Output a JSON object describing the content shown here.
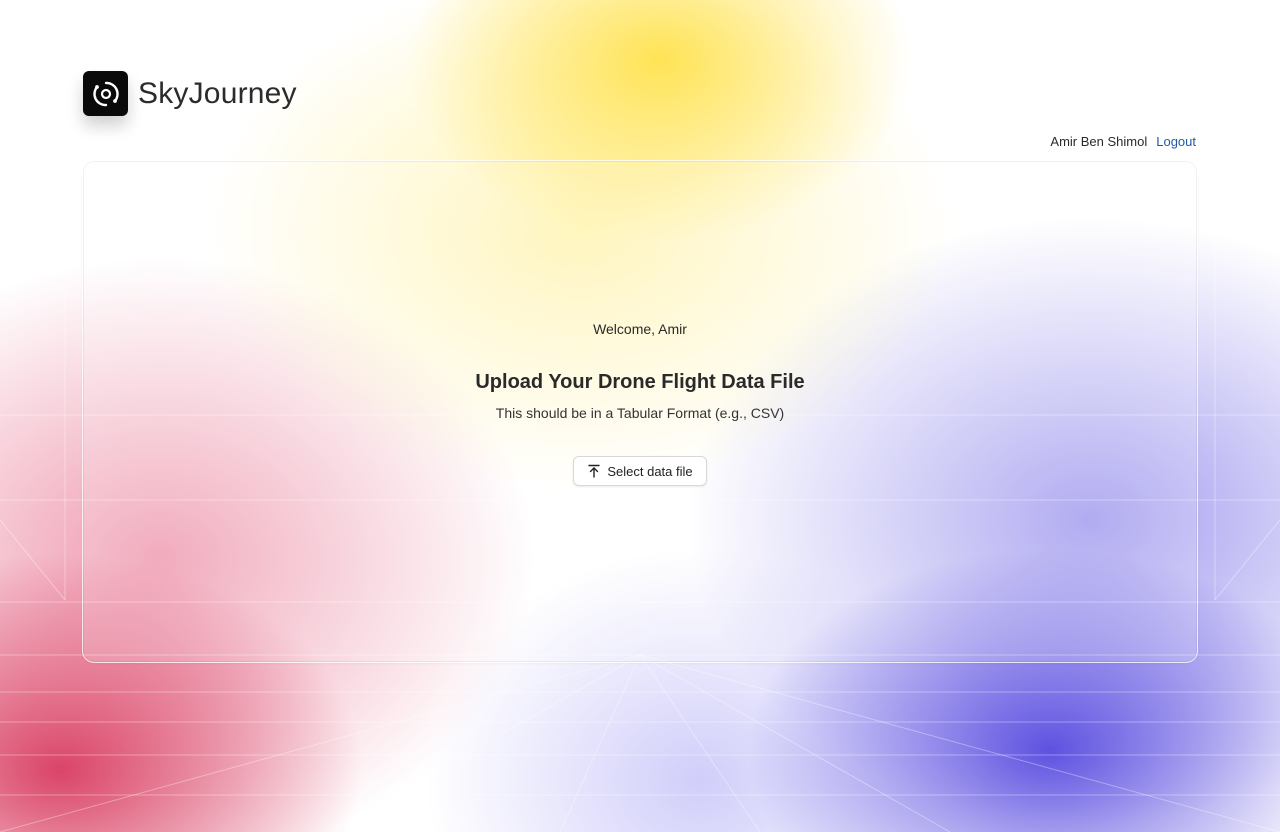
{
  "app": {
    "brand": "SkyJourney",
    "logo_icon": "orbit-icon"
  },
  "user": {
    "name": "Amir Ben Shimol",
    "logout_label": "Logout"
  },
  "main": {
    "welcome": "Welcome, Amir",
    "title": "Upload Your Drone Flight Data File",
    "subtitle": "This should be in a Tabular Format (e.g., CSV)",
    "select_button_label": "Select data file",
    "select_button_icon": "upload-icon"
  },
  "colors": {
    "link": "#1f5aa8",
    "logo_bg": "#0a0a0a",
    "gradient_yellow": "#ffdf3c",
    "gradient_red": "#d42850",
    "gradient_blue": "#4637dc"
  }
}
